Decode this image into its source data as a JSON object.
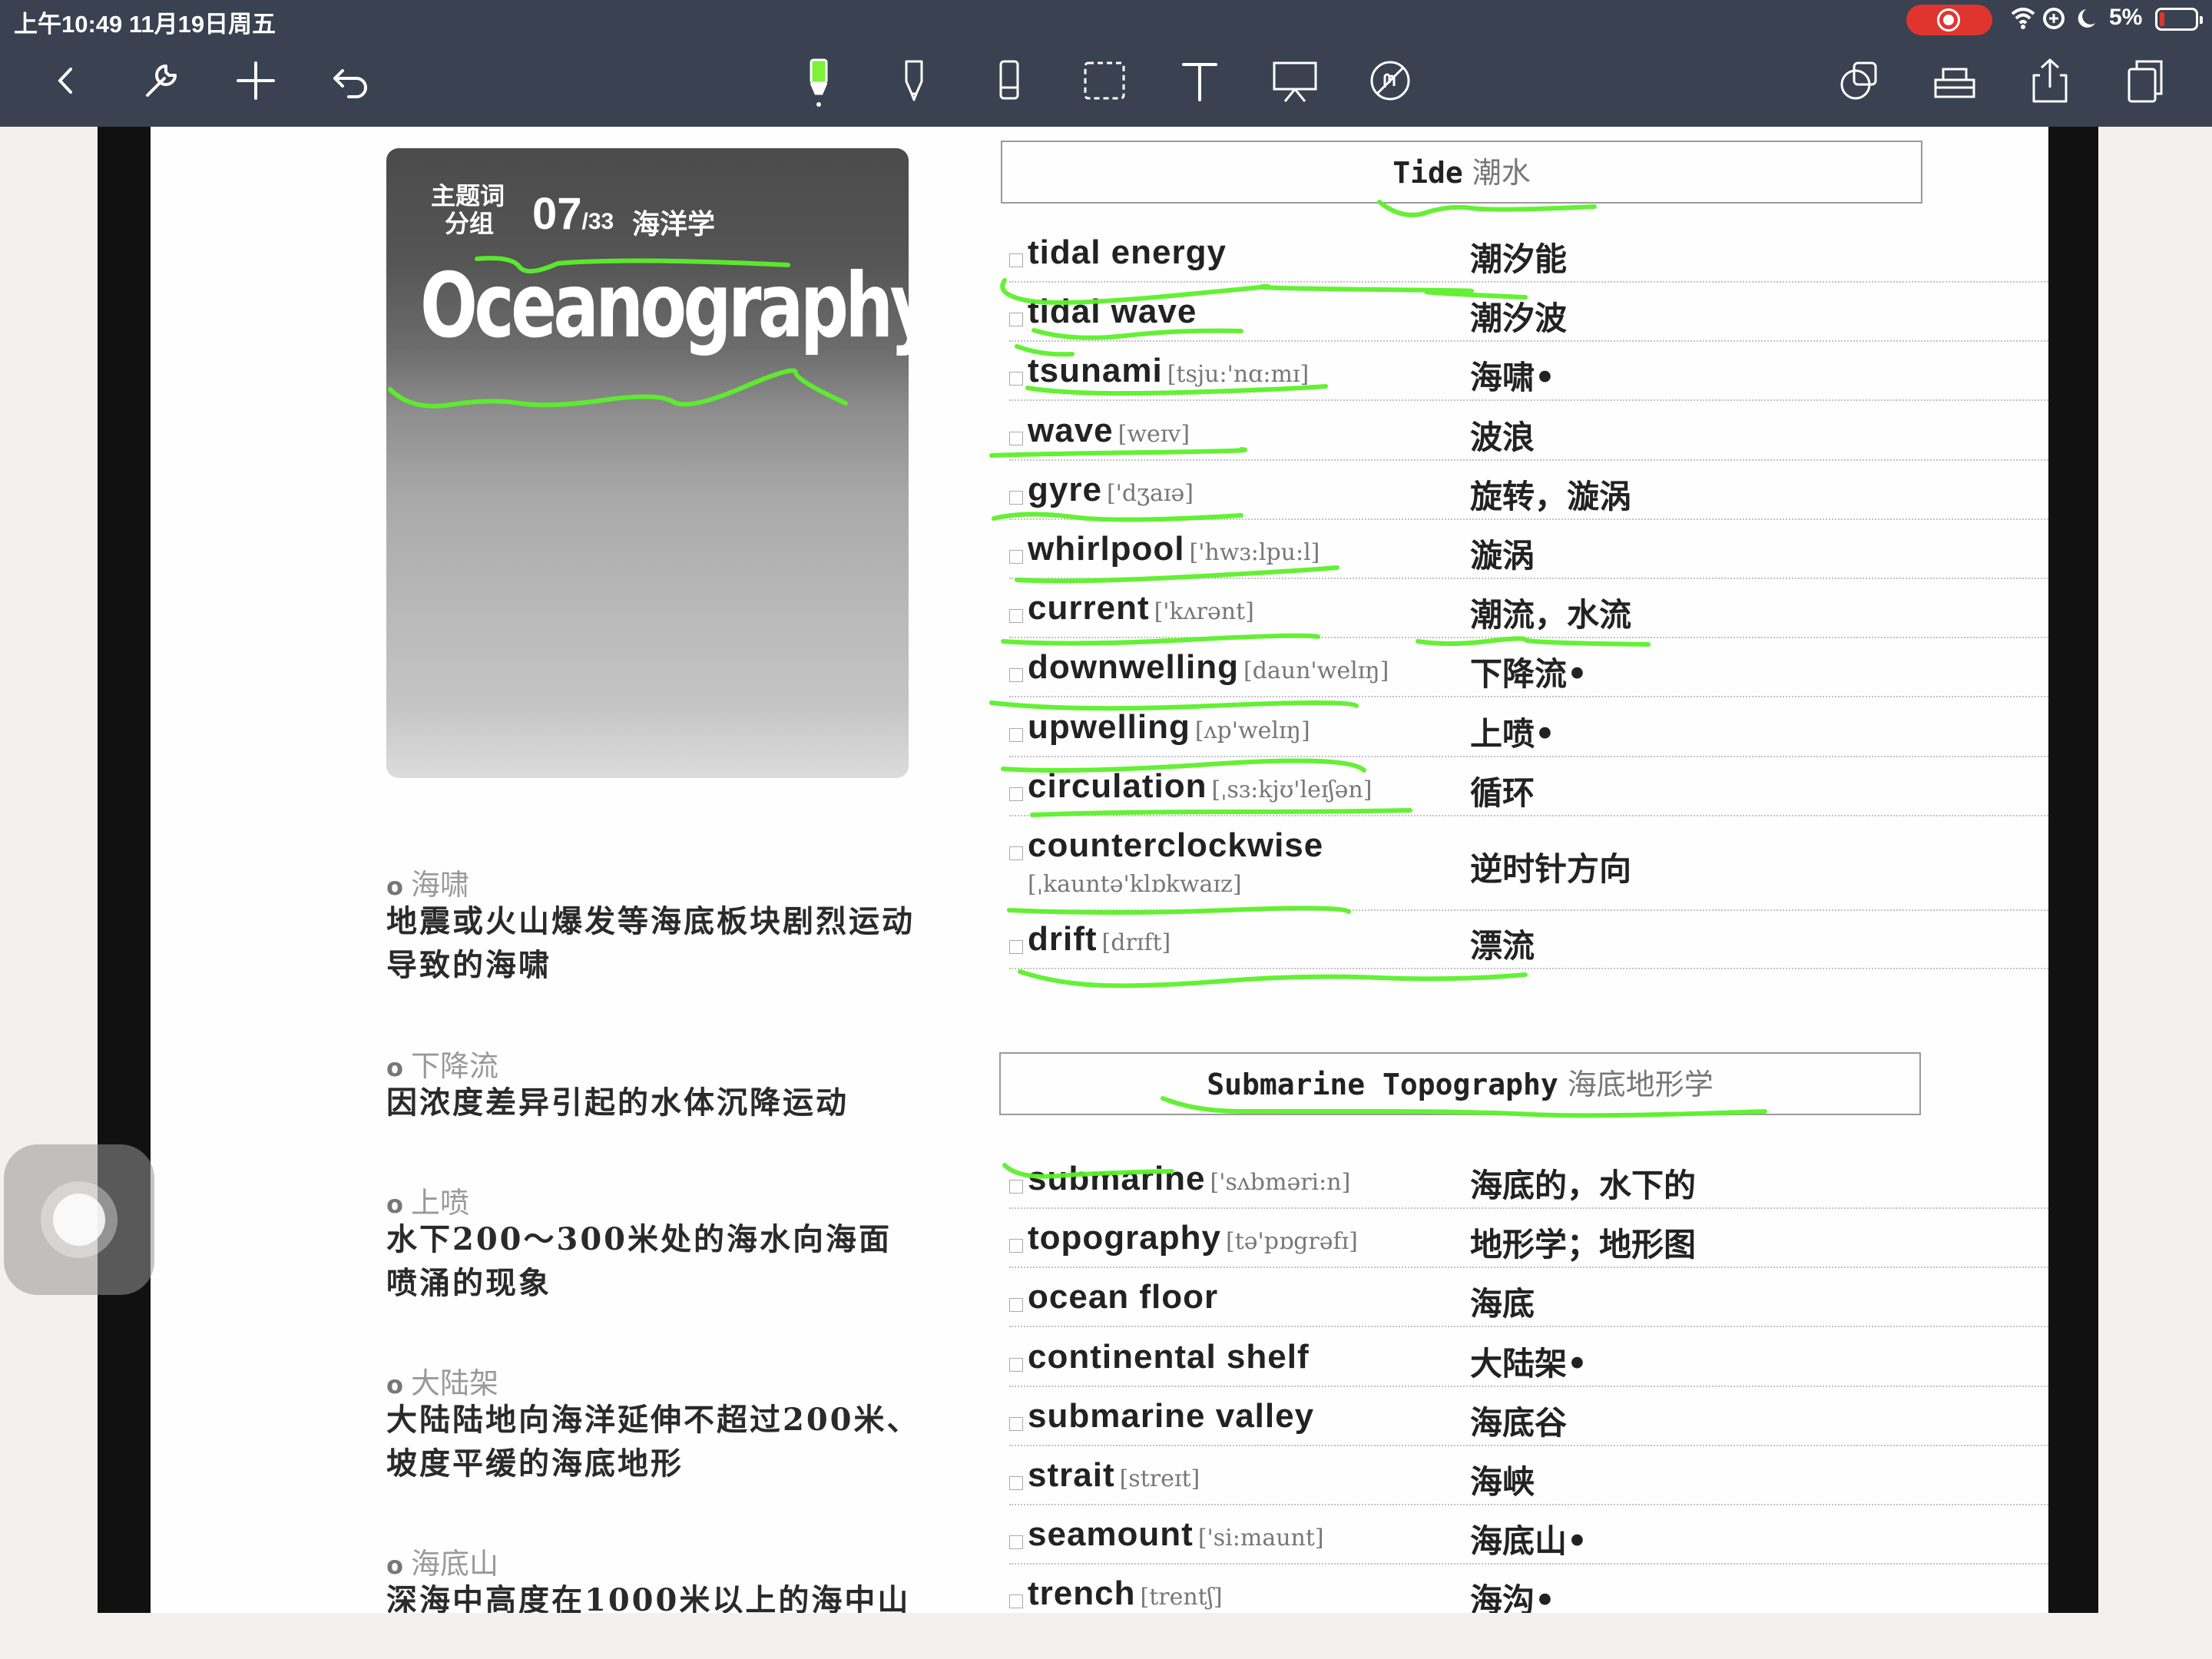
{
  "status_bar": {
    "time": "上午10:49   11月19日周五",
    "battery": "5%"
  },
  "toolbar": {
    "left": [
      {
        "name": "back-button",
        "icon": "chevron-left-icon"
      },
      {
        "name": "settings-button",
        "icon": "wrench-icon"
      },
      {
        "name": "add-button",
        "icon": "plus-icon"
      },
      {
        "name": "undo-button",
        "icon": "undo-icon"
      }
    ],
    "tools": [
      {
        "name": "highlighter-tool",
        "icon": "highlighter-icon",
        "active": true
      },
      {
        "name": "pen-tool",
        "icon": "pen-icon"
      },
      {
        "name": "eraser-tool",
        "icon": "eraser-icon"
      },
      {
        "name": "lasso-tool",
        "icon": "lasso-select-icon"
      },
      {
        "name": "text-tool",
        "icon": "text-icon"
      },
      {
        "name": "whiteboard-tool",
        "icon": "board-icon"
      },
      {
        "name": "link-tool",
        "icon": "no-touch-icon"
      }
    ],
    "right": [
      {
        "name": "shapes-button",
        "icon": "shapes-icon"
      },
      {
        "name": "marketplace-button",
        "icon": "tray-icon"
      },
      {
        "name": "share-button",
        "icon": "share-icon"
      },
      {
        "name": "pages-button",
        "icon": "pages-icon"
      }
    ],
    "accent_color": "#7cf23a"
  },
  "cover": {
    "sub_line1": "主题词",
    "sub_line2": "分组",
    "number": "07",
    "number_total": "/33",
    "topic": "海洋学",
    "title": "Oceanography"
  },
  "notes": [
    {
      "head": "海啸",
      "body": "地震或火山爆发等海底板块剧烈运动导致的海啸"
    },
    {
      "head": "下降流",
      "body": "因浓度差异引起的水体沉降运动"
    },
    {
      "head": "上喷",
      "body": "水下200～300米处的海水向海面喷涌的现象"
    },
    {
      "head": "大陆架",
      "body": "大陆陆地向海洋延伸不超过200米、坡度平缓的海底地形"
    },
    {
      "head": "海底山",
      "body": "深海中高度在1000米以上的海中山"
    }
  ],
  "sections": [
    {
      "title_en": "Tide",
      "title_zh": "潮水",
      "rows": [
        {
          "en": "tidal energy",
          "ph": "",
          "zh": "潮汐能"
        },
        {
          "en": "tidal wave",
          "ph": "",
          "zh": "潮汐波"
        },
        {
          "en": "tsunami",
          "ph": "[tsju:'nɑ:mɪ]",
          "zh": "海啸•"
        },
        {
          "en": "wave",
          "ph": "[weɪv]",
          "zh": "波浪"
        },
        {
          "en": "gyre",
          "ph": "['dʒaɪə]",
          "zh": "旋转，漩涡"
        },
        {
          "en": "whirlpool",
          "ph": "['hwɜ:lpu:l]",
          "zh": "漩涡"
        },
        {
          "en": "current",
          "ph": "['kʌrənt]",
          "zh": "潮流，水流"
        },
        {
          "en": "downwelling",
          "ph": "[daun'welɪŋ]",
          "zh": "下降流•"
        },
        {
          "en": "upwelling",
          "ph": "[ʌp'welɪŋ]",
          "zh": "上喷•"
        },
        {
          "en": "circulation",
          "ph": "[ˌsɜ:kjʊ'leɪʃən]",
          "zh": "循环"
        },
        {
          "en": "counterclockwise",
          "ph": "[ˌkauntə'klɒkwaɪz]",
          "zh": "逆时针方向",
          "tall": true
        },
        {
          "en": "drift",
          "ph": "[drɪft]",
          "zh": "漂流"
        }
      ]
    },
    {
      "title_en": "Submarine Topography",
      "title_zh": "海底地形学",
      "rows": [
        {
          "en": "submarine",
          "ph": "['sʌbməri:n]",
          "zh": "海底的，水下的"
        },
        {
          "en": "topography",
          "ph": "[tə'pɒgrəfɪ]",
          "zh": "地形学；地形图"
        },
        {
          "en": "ocean floor",
          "ph": "",
          "zh": "海底"
        },
        {
          "en": "continental shelf",
          "ph": "",
          "zh": "大陆架•"
        },
        {
          "en": "submarine valley",
          "ph": "",
          "zh": "海底谷"
        },
        {
          "en": "strait",
          "ph": "[streɪt]",
          "zh": "海峡"
        },
        {
          "en": "seamount",
          "ph": "['si:maunt]",
          "zh": "海底山•"
        },
        {
          "en": "trench",
          "ph": "[trentʃ]",
          "zh": "海沟•"
        }
      ]
    }
  ]
}
